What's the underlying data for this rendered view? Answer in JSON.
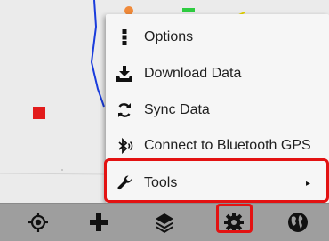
{
  "menu": {
    "items": [
      {
        "label": "Options",
        "icon": "more-vert-icon"
      },
      {
        "label": "Download Data",
        "icon": "download-icon"
      },
      {
        "label": "Sync Data",
        "icon": "sync-icon"
      },
      {
        "label": "Connect to Bluetooth GPS",
        "icon": "bluetooth-icon"
      },
      {
        "label": "Tools",
        "icon": "wrench-icon",
        "has_submenu": true,
        "submenu_glyph": "▸"
      }
    ]
  },
  "bottom_bar": {
    "buttons": [
      {
        "name": "my-location-button",
        "icon": "crosshair-icon"
      },
      {
        "name": "add-button",
        "icon": "plus-icon"
      },
      {
        "name": "layers-button",
        "icon": "layers-icon"
      },
      {
        "name": "settings-button",
        "icon": "gear-icon"
      },
      {
        "name": "globe-button",
        "icon": "globe-icon"
      }
    ]
  },
  "colors": {
    "highlight": "#e31212",
    "map_marker": "#e21b1b",
    "route_line": "#1a3cdc",
    "bar_background": "#9e9e9e"
  }
}
